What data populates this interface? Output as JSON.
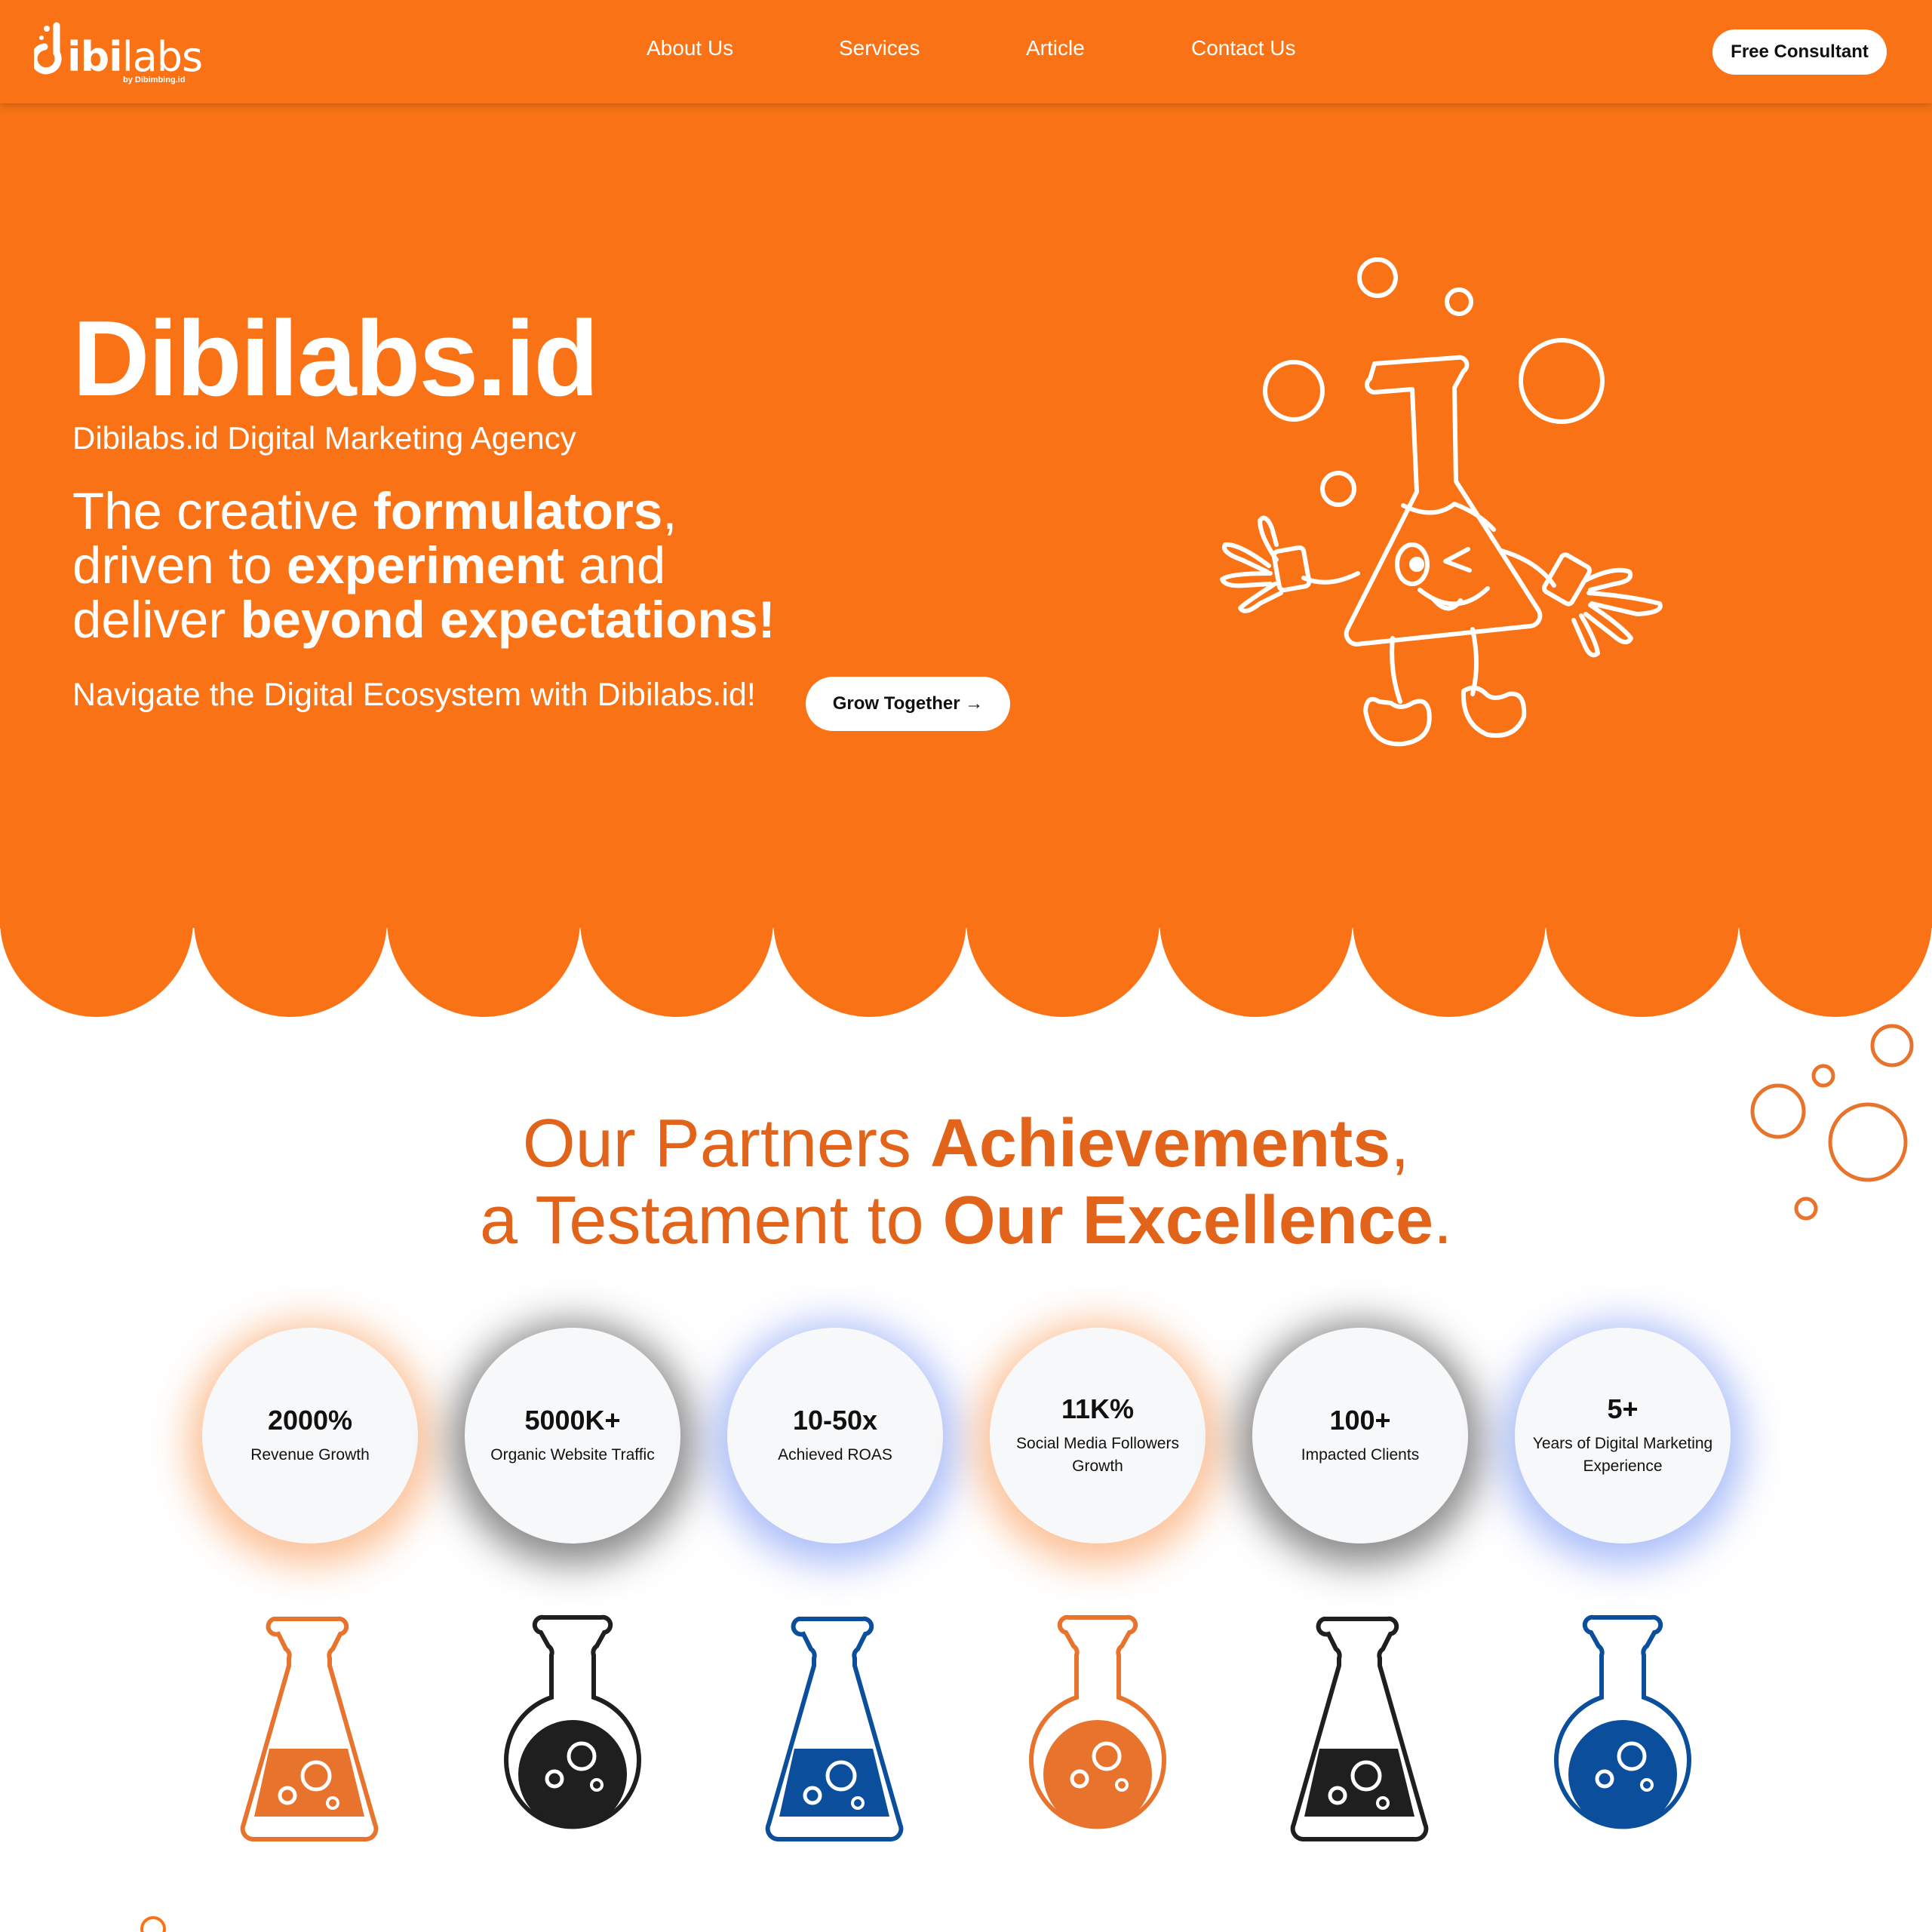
{
  "brand": {
    "logo_main": "ibi",
    "logo_light": "labs",
    "logo_sub": "by Dibimbing.id"
  },
  "nav": {
    "about": "About Us",
    "services": "Services",
    "article": "Article",
    "contact": "Contact Us",
    "cta": "Free Consultant"
  },
  "hero": {
    "title": "Dibilabs.id",
    "subtitle": "Dibilabs.id Digital Marketing Agency",
    "tagline": {
      "l1_a": "The creative ",
      "l1_b": "formulators",
      "l1_c": ",",
      "l2_a": "driven to ",
      "l2_b": "experiment",
      "l2_c": " and",
      "l3_a": "deliver ",
      "l3_b": "beyond expectations!"
    },
    "navigate": "Navigate the Digital Ecosystem with Dibilabs.id!",
    "cta": "Grow Together →"
  },
  "achievements": {
    "title": {
      "l1_a": "Our Partners ",
      "l1_b": "Achievements",
      "l1_c": ",",
      "l2_a": "a Testament to ",
      "l2_b": "Our Excellence",
      "l2_c": "."
    },
    "stats": [
      {
        "value": "2000%",
        "label": "Revenue Growth",
        "glow": "orange"
      },
      {
        "value": "5000K+",
        "label": "Organic Website Traffic",
        "glow": "dark"
      },
      {
        "value": "10-50x",
        "label": "Achieved ROAS",
        "glow": "blue"
      },
      {
        "value": "11K%",
        "label": "Social Media Followers Growth",
        "glow": "orange"
      },
      {
        "value": "100+",
        "label": "Impacted Clients",
        "glow": "dark"
      },
      {
        "value": "5+",
        "label": "Years of Digital Marketing Experience",
        "glow": "blue"
      }
    ]
  },
  "colors": {
    "brand_orange": "#f97316",
    "title_orange": "#e2631a",
    "flask_orange": "#e8732c",
    "flask_dark": "#1f1f1f",
    "flask_blue": "#0b4f9c"
  },
  "icons": {
    "mascot": "flask-mascot-icon",
    "flasks": [
      "erlenmeyer-flask-icon",
      "round-flask-icon",
      "erlenmeyer-flask-icon",
      "round-flask-icon",
      "erlenmeyer-flask-icon",
      "round-flask-icon"
    ]
  }
}
